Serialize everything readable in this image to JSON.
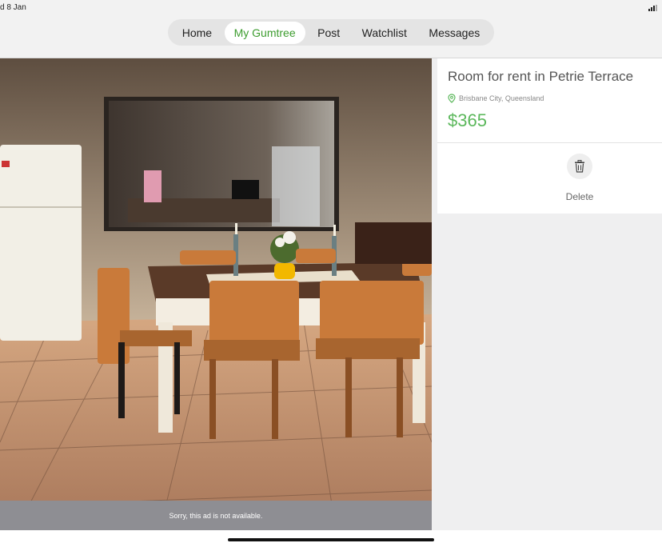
{
  "status_bar": {
    "time": "d 8 Jan"
  },
  "nav": {
    "items": [
      {
        "label": "Home"
      },
      {
        "label": "My Gumtree"
      },
      {
        "label": "Post"
      },
      {
        "label": "Watchlist"
      },
      {
        "label": "Messages"
      }
    ],
    "active_index": 1
  },
  "photo": {
    "unavailable_text": "Sorry, this ad is not available."
  },
  "listing": {
    "title": "Room for rent in Petrie Terrace",
    "location": "Brisbane City, Queensland",
    "price": "$365",
    "delete_label": "Delete"
  },
  "colors": {
    "brand_green": "#3c9c2e",
    "price_green": "#5cb85c"
  }
}
